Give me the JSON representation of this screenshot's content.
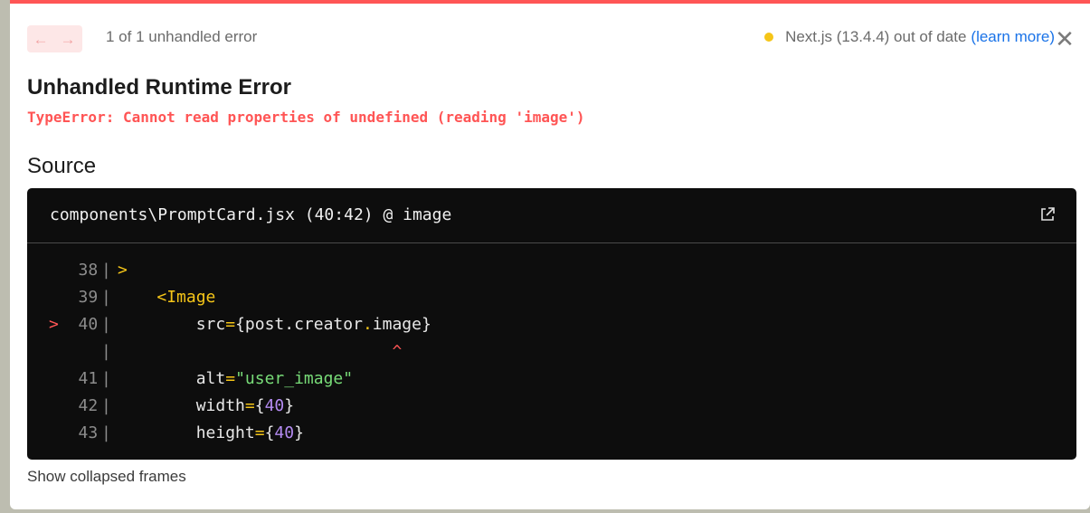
{
  "nav": {
    "prev_icon": "arrow-left-icon",
    "next_icon": "arrow-right-icon",
    "prev_glyph": "←",
    "next_glyph": "→"
  },
  "error_count": "1 of 1 unhandled error",
  "version": {
    "text": "Next.js (13.4.4) out of date",
    "link": "(learn more)"
  },
  "close_glyph": "✕",
  "title": "Unhandled Runtime Error",
  "message": "TypeError: Cannot read properties of undefined (reading 'image')",
  "source_heading": "Source",
  "code": {
    "file": "components\\PromptCard.jsx (40:42) @ image",
    "lines": [
      {
        "num": "38",
        "marker": " ",
        "text": ">"
      },
      {
        "num": "39",
        "marker": " ",
        "text": "    <Image"
      },
      {
        "num": "40",
        "marker": ">",
        "text": "        src={post.creator.image}"
      },
      {
        "num": "",
        "marker": " ",
        "text": "                            ^"
      },
      {
        "num": "41",
        "marker": " ",
        "text": "        alt=\"user_image\""
      },
      {
        "num": "42",
        "marker": " ",
        "text": "        width={40}"
      },
      {
        "num": "43",
        "marker": " ",
        "text": "        height={40}"
      }
    ]
  },
  "show_collapsed": "Show collapsed frames",
  "colors": {
    "accent": "#ff5555",
    "warning_dot": "#f5c518",
    "link": "#1a73e8",
    "code_bg": "#0d0d0d"
  }
}
